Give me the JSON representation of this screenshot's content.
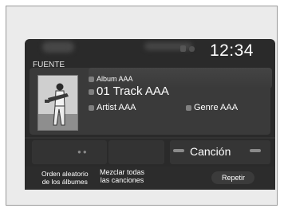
{
  "status_bar": {
    "clock": "12:34"
  },
  "source": {
    "label": "FUENTE"
  },
  "now_playing": {
    "album": "Album AAA",
    "track": "01 Track AAA",
    "artist": "Artist AAA",
    "genre": "Genre AAA"
  },
  "mode": {
    "label": "Canción"
  },
  "options": {
    "shuffle_albums": [
      "Orden aleatorio",
      "de los álbumes"
    ],
    "shuffle_all": [
      "Mezclar todas",
      "las canciones"
    ],
    "repeat": "Repetir"
  },
  "icons": {
    "album": "disc-icon",
    "artist": "person-icon",
    "genre": "genre-icon"
  }
}
